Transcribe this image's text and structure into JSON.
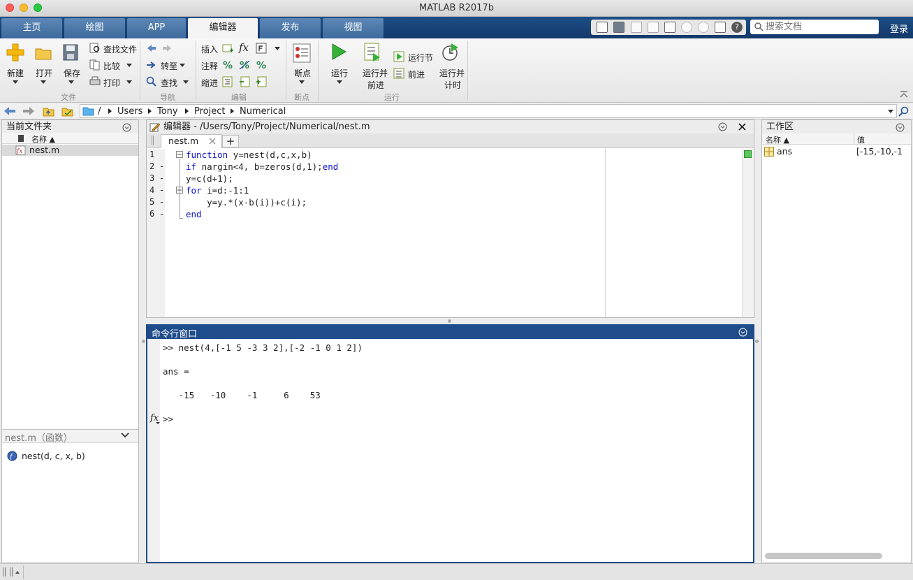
{
  "window": {
    "title": "MATLAB R2017b"
  },
  "tabs": [
    "主页",
    "绘图",
    "APP",
    "编辑器",
    "发布",
    "视图"
  ],
  "search": {
    "placeholder": "搜索文档"
  },
  "login_label": "登录",
  "ribbon": {
    "file": {
      "new": "新建",
      "open": "打开",
      "save": "保存",
      "find_files": "查找文件",
      "compare": "比较",
      "print": "打印",
      "group": "文件"
    },
    "nav": {
      "goto": "转至",
      "find": "查找",
      "group": "导航"
    },
    "edit": {
      "insert": "插入",
      "comment": "注释",
      "indent": "缩进",
      "group": "编辑"
    },
    "breakpoints": {
      "label": "断点",
      "group": "断点"
    },
    "run": {
      "run": "运行",
      "run_advance_1": "运行并",
      "run_advance_2": "前进",
      "run_section": "运行节",
      "advance": "前进",
      "run_time_1": "运行并",
      "run_time_2": "计时",
      "group": "运行"
    }
  },
  "breadcrumb": [
    "/",
    "Users",
    "Tony",
    "Project",
    "Numerical"
  ],
  "current_folder": {
    "title": "当前文件夹",
    "column": "名称 ▲",
    "files": [
      "nest.m"
    ],
    "details_title": "nest.m（函数）",
    "details_signature": "nest(d, c, x, b)"
  },
  "editor": {
    "title": "编辑器 - /Users/Tony/Project/Numerical/nest.m",
    "tab": "nest.m",
    "add_tab": "+",
    "lines": [
      {
        "n": "1",
        "dash": "",
        "parts": [
          [
            "kw",
            "function"
          ],
          [
            "",
            " y=nest(d,c,x,b)"
          ]
        ]
      },
      {
        "n": "2",
        "dash": "-",
        "parts": [
          [
            "kw",
            "if"
          ],
          [
            "",
            " nargin<4, b=zeros(d,1);"
          ],
          [
            "kw",
            "end"
          ]
        ]
      },
      {
        "n": "3",
        "dash": "-",
        "parts": [
          [
            "",
            "y=c(d+1);"
          ]
        ]
      },
      {
        "n": "4",
        "dash": "-",
        "parts": [
          [
            "kw",
            "for"
          ],
          [
            "",
            " i=d:-1:1"
          ]
        ]
      },
      {
        "n": "5",
        "dash": "-",
        "parts": [
          [
            "",
            "    y=y.*(x-b(i))+c(i);"
          ]
        ]
      },
      {
        "n": "6",
        "dash": "-",
        "parts": [
          [
            "kw",
            "end"
          ]
        ]
      }
    ]
  },
  "command_window": {
    "title": "命令行窗口",
    "lines": [
      ">> nest(4,[-1 5 -3 3 2],[-2 -1 0 1 2])",
      "",
      "ans =",
      "",
      "   -15   -10    -1     6    53",
      "",
      ">>"
    ],
    "fx": "fx"
  },
  "workspace": {
    "title": "工作区",
    "col_name": "名称 ▲",
    "col_value": "值",
    "vars": [
      {
        "name": "ans",
        "value": "[-15,-10,-1"
      }
    ]
  },
  "colors": {
    "accent": "#1c4f86",
    "keyword": "#0e12cc",
    "cmd_header": "#1f4c8a"
  }
}
